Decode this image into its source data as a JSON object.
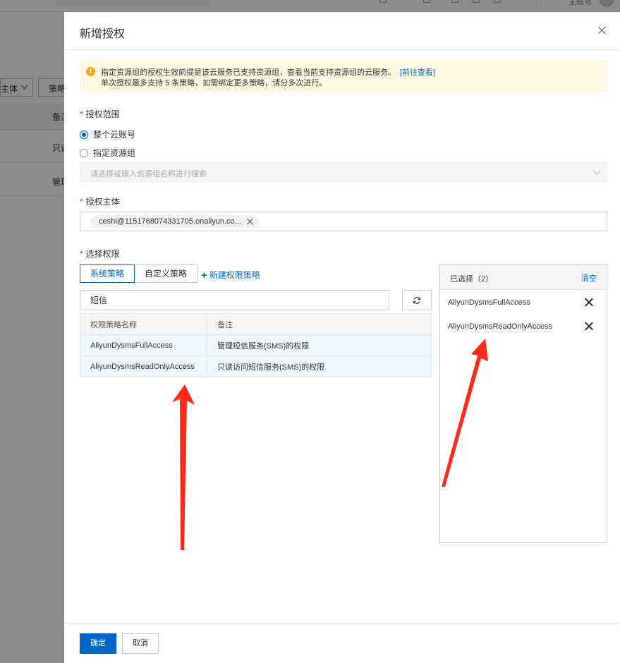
{
  "background": {
    "account_label": "主账号",
    "filter_select_label": "主体",
    "filter_button_label": "策略",
    "table_header": "备注",
    "rows": [
      "只读",
      "管理"
    ]
  },
  "drawer": {
    "title": "新增授权",
    "notice": {
      "line1": "指定资源组的授权生效前提是该云服务已支持资源组，查看当前支持资源组的云服务。",
      "link": "[前往查看]",
      "line2": "单次授权最多支持 5 条策略，如需绑定更多策略，请分多次进行。"
    },
    "scope": {
      "label": "授权范围",
      "options": [
        "整个云账号",
        "指定资源组"
      ],
      "selected": "整个云账号",
      "resource_group_placeholder": "请选择或输入资源组名称进行搜索"
    },
    "principal": {
      "label": "授权主体",
      "tag": "ceshi@1151768074331705.onaliyun.co..."
    },
    "permissions": {
      "label": "选择权限",
      "tabs": [
        "系统策略",
        "自定义策略"
      ],
      "active_tab": "系统策略",
      "new_policy": "新建权限策略",
      "search_value": "短信",
      "columns": [
        "权限策略名称",
        "备注"
      ],
      "rows": [
        {
          "name": "AliyunDysmsFullAccess",
          "note": "管理短信服务(SMS)的权限"
        },
        {
          "name": "AliyunDysmsReadOnlyAccess",
          "note": "只读访问短信服务(SMS)的权限"
        }
      ]
    },
    "selected": {
      "title": "已选择（2）",
      "clear": "清空",
      "items": [
        "AliyunDysmsFullAccess",
        "AliyunDysmsReadOnlyAccess"
      ]
    },
    "footer": {
      "confirm": "确定",
      "cancel": "取消"
    }
  },
  "colors": {
    "primary": "#0064c8",
    "notice_bg": "#fff8e1",
    "warning": "#f5a623",
    "required": "#d93026",
    "annotation_arrow": "#ff2a1a"
  }
}
